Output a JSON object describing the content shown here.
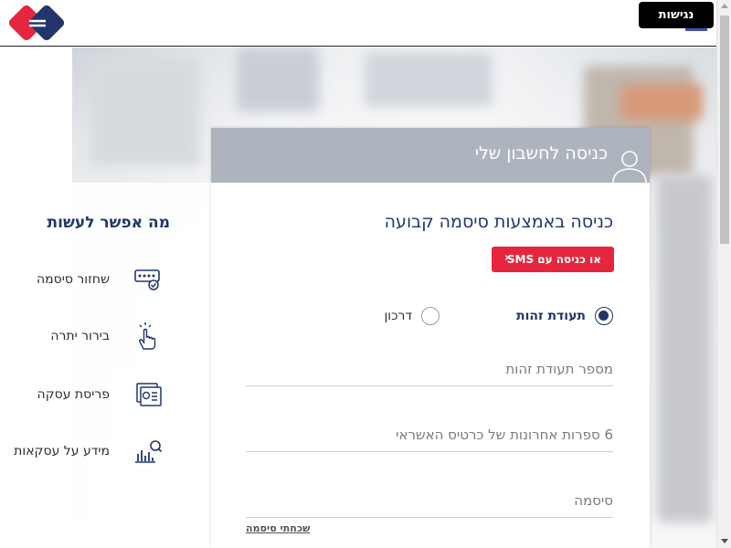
{
  "header": {
    "access_label": "נגישות"
  },
  "features": {
    "title": "מה אפשר לעשות",
    "items": [
      {
        "label": "שחזור סיסמה",
        "icon": "password-check-icon"
      },
      {
        "label": "בירור יתרה",
        "icon": "touch-hand-icon"
      },
      {
        "label": "פריסת עסקה",
        "icon": "card-statement-icon"
      },
      {
        "label": "מידע על עסקאות",
        "icon": "chart-search-icon"
      }
    ]
  },
  "login": {
    "header_title": "כניסה לחשבון שלי",
    "title": "כניסה באמצעות סיסמה קבועה",
    "sms_button": "או כניסה עם SMS",
    "id_type_options": [
      {
        "label": "תעודת זהות",
        "selected": true
      },
      {
        "label": "דרכון",
        "selected": false
      }
    ],
    "fields": {
      "id_placeholder": "מספר תעודת זהות",
      "card_placeholder": "6 ספרות אחרונות של כרטיס האשראי",
      "password_placeholder": "סיסמה"
    },
    "forgot_password": "שכחתי סיסמה"
  },
  "colors": {
    "brand_blue": "#22366b",
    "brand_red": "#e6263e",
    "card_header": "#adb4bd"
  }
}
